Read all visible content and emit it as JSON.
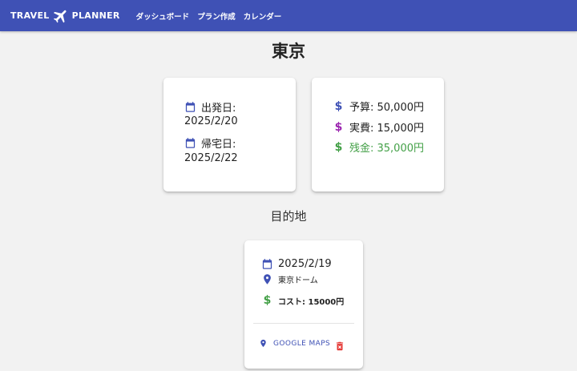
{
  "app": {
    "logo_left": "TRAVEL",
    "logo_right": "PLANNER",
    "nav": [
      "ダッシュボード",
      "プラン作成",
      "カレンダー"
    ]
  },
  "page": {
    "title": "東京",
    "destinations_heading": "目的地"
  },
  "dates": {
    "departure_label": "出発日:",
    "departure_date": "2025/2/20",
    "return_label": "帰宅日:",
    "return_date": "2025/2/22"
  },
  "budget": {
    "budget_text": "予算: 50,000円",
    "actual_text": "実費: 15,000円",
    "remaining_text": "残金: 35,000円"
  },
  "destination": {
    "date": "2025/2/19",
    "place": "東京ドーム",
    "cost": "コスト: 15000円",
    "maps_label": "GOOGLE MAPS"
  },
  "icons": {
    "calendar": "calendar-icon",
    "dollar": "dollar-icon",
    "location": "location-pin-icon",
    "delete": "trash-icon",
    "plane": "airplane-icon"
  },
  "colors": {
    "primary": "#3f51b5",
    "budget": "#3f51b5",
    "actual": "#9c27b0",
    "remaining": "#43a047",
    "delete": "#e53935",
    "background": "#f2f2f2"
  }
}
